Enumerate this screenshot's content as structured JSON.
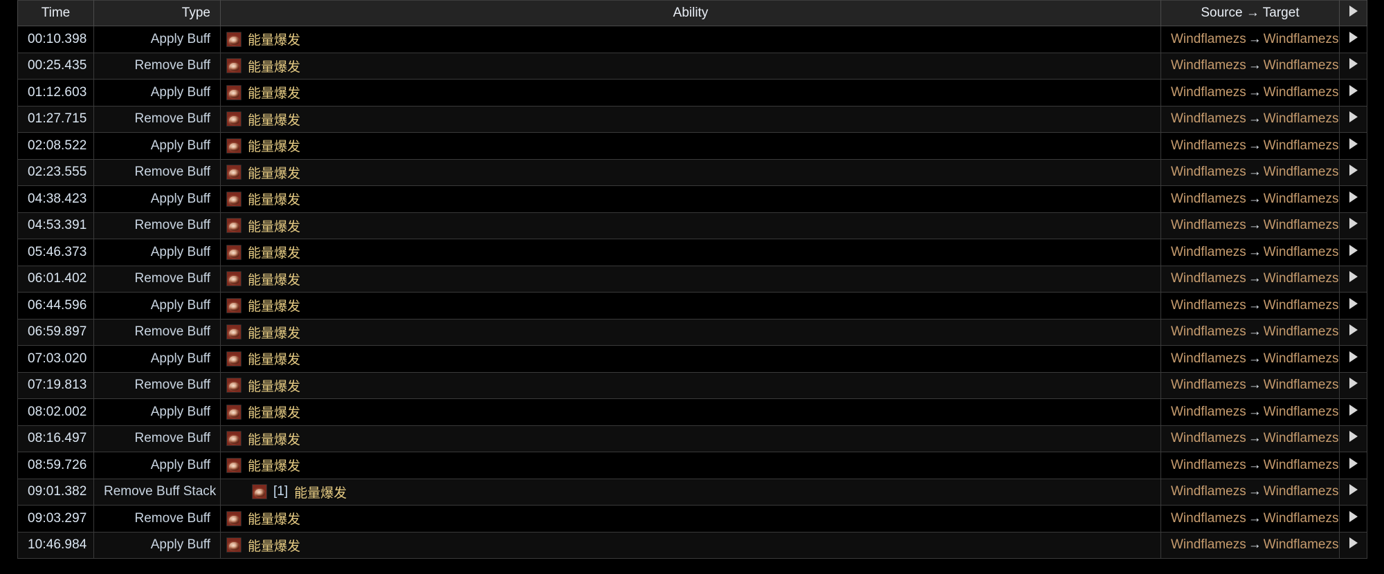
{
  "table": {
    "columns": [
      {
        "key": "time",
        "label": "Time"
      },
      {
        "key": "type",
        "label": "Type"
      },
      {
        "key": "ability",
        "label": "Ability"
      },
      {
        "key": "source",
        "label": "Source → Target"
      },
      {
        "key": "expand",
        "label": ""
      }
    ],
    "header": {
      "time": "Time",
      "type": "Type",
      "ability": "Ability",
      "source_target": "Source → Target",
      "expand_icon": "caret-right-icon"
    },
    "colors": {
      "header_bg": "#242424",
      "row_bg_odd": "#000000",
      "row_bg_even": "#0e0e0e",
      "grid_line": "#3a3a3a",
      "time_text": "#dbe6f2",
      "type_text": "#c9d5e2",
      "ability_text": "#e6cb83",
      "source_text": "#c79c6e",
      "arrow_text": "#e3e9f0",
      "stack_text": "#c8dcf0",
      "expand_arrow": "#d8d8d8",
      "icon_red": "#c22a2c"
    },
    "rows": [
      {
        "time": "00:10.398",
        "type": "Apply Buff",
        "icon": "energy-burst-icon",
        "stack": "",
        "ability": "能量爆发",
        "source": "Windflamezs",
        "arrow": "→",
        "target": "Windflamezs",
        "expand": "caret-right-icon"
      },
      {
        "time": "00:25.435",
        "type": "Remove Buff",
        "icon": "energy-burst-icon",
        "stack": "",
        "ability": "能量爆发",
        "source": "Windflamezs",
        "arrow": "→",
        "target": "Windflamezs",
        "expand": "caret-right-icon"
      },
      {
        "time": "01:12.603",
        "type": "Apply Buff",
        "icon": "energy-burst-icon",
        "stack": "",
        "ability": "能量爆发",
        "source": "Windflamezs",
        "arrow": "→",
        "target": "Windflamezs",
        "expand": "caret-right-icon"
      },
      {
        "time": "01:27.715",
        "type": "Remove Buff",
        "icon": "energy-burst-icon",
        "stack": "",
        "ability": "能量爆发",
        "source": "Windflamezs",
        "arrow": "→",
        "target": "Windflamezs",
        "expand": "caret-right-icon"
      },
      {
        "time": "02:08.522",
        "type": "Apply Buff",
        "icon": "energy-burst-icon",
        "stack": "",
        "ability": "能量爆发",
        "source": "Windflamezs",
        "arrow": "→",
        "target": "Windflamezs",
        "expand": "caret-right-icon"
      },
      {
        "time": "02:23.555",
        "type": "Remove Buff",
        "icon": "energy-burst-icon",
        "stack": "",
        "ability": "能量爆发",
        "source": "Windflamezs",
        "arrow": "→",
        "target": "Windflamezs",
        "expand": "caret-right-icon"
      },
      {
        "time": "04:38.423",
        "type": "Apply Buff",
        "icon": "energy-burst-icon",
        "stack": "",
        "ability": "能量爆发",
        "source": "Windflamezs",
        "arrow": "→",
        "target": "Windflamezs",
        "expand": "caret-right-icon"
      },
      {
        "time": "04:53.391",
        "type": "Remove Buff",
        "icon": "energy-burst-icon",
        "stack": "",
        "ability": "能量爆发",
        "source": "Windflamezs",
        "arrow": "→",
        "target": "Windflamezs",
        "expand": "caret-right-icon"
      },
      {
        "time": "05:46.373",
        "type": "Apply Buff",
        "icon": "energy-burst-icon",
        "stack": "",
        "ability": "能量爆发",
        "source": "Windflamezs",
        "arrow": "→",
        "target": "Windflamezs",
        "expand": "caret-right-icon"
      },
      {
        "time": "06:01.402",
        "type": "Remove Buff",
        "icon": "energy-burst-icon",
        "stack": "",
        "ability": "能量爆发",
        "source": "Windflamezs",
        "arrow": "→",
        "target": "Windflamezs",
        "expand": "caret-right-icon"
      },
      {
        "time": "06:44.596",
        "type": "Apply Buff",
        "icon": "energy-burst-icon",
        "stack": "",
        "ability": "能量爆发",
        "source": "Windflamezs",
        "arrow": "→",
        "target": "Windflamezs",
        "expand": "caret-right-icon"
      },
      {
        "time": "06:59.897",
        "type": "Remove Buff",
        "icon": "energy-burst-icon",
        "stack": "",
        "ability": "能量爆发",
        "source": "Windflamezs",
        "arrow": "→",
        "target": "Windflamezs",
        "expand": "caret-right-icon"
      },
      {
        "time": "07:03.020",
        "type": "Apply Buff",
        "icon": "energy-burst-icon",
        "stack": "",
        "ability": "能量爆发",
        "source": "Windflamezs",
        "arrow": "→",
        "target": "Windflamezs",
        "expand": "caret-right-icon"
      },
      {
        "time": "07:19.813",
        "type": "Remove Buff",
        "icon": "energy-burst-icon",
        "stack": "",
        "ability": "能量爆发",
        "source": "Windflamezs",
        "arrow": "→",
        "target": "Windflamezs",
        "expand": "caret-right-icon"
      },
      {
        "time": "08:02.002",
        "type": "Apply Buff",
        "icon": "energy-burst-icon",
        "stack": "",
        "ability": "能量爆发",
        "source": "Windflamezs",
        "arrow": "→",
        "target": "Windflamezs",
        "expand": "caret-right-icon"
      },
      {
        "time": "08:16.497",
        "type": "Remove Buff",
        "icon": "energy-burst-icon",
        "stack": "",
        "ability": "能量爆发",
        "source": "Windflamezs",
        "arrow": "→",
        "target": "Windflamezs",
        "expand": "caret-right-icon"
      },
      {
        "time": "08:59.726",
        "type": "Apply Buff",
        "icon": "energy-burst-icon",
        "stack": "",
        "ability": "能量爆发",
        "source": "Windflamezs",
        "arrow": "→",
        "target": "Windflamezs",
        "expand": "caret-right-icon"
      },
      {
        "time": "09:01.382",
        "type": "Remove Buff Stack",
        "icon": "energy-burst-icon",
        "stack": "[1]",
        "ability": "能量爆发",
        "source": "Windflamezs",
        "arrow": "→",
        "target": "Windflamezs",
        "expand": "caret-right-icon"
      },
      {
        "time": "09:03.297",
        "type": "Remove Buff",
        "icon": "energy-burst-icon",
        "stack": "",
        "ability": "能量爆发",
        "source": "Windflamezs",
        "arrow": "→",
        "target": "Windflamezs",
        "expand": "caret-right-icon"
      },
      {
        "time": "10:46.984",
        "type": "Apply Buff",
        "icon": "energy-burst-icon",
        "stack": "",
        "ability": "能量爆发",
        "source": "Windflamezs",
        "arrow": "→",
        "target": "Windflamezs",
        "expand": "caret-right-icon"
      }
    ]
  }
}
